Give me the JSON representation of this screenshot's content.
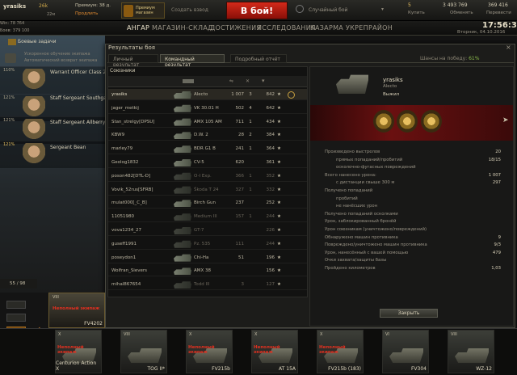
{
  "topbar": {
    "username": "yrasiks",
    "xp_label": "26k",
    "xp_total": "22м",
    "premium_label": "Премиум: 38 д.",
    "extend_label": "Продлить",
    "premium_shop": "Премиум магазин",
    "create_platoon": "Создать взвод",
    "battle_button": "В бой!",
    "battle_mode": "Случайный бой",
    "gold": "5",
    "buy_label": "Купить",
    "credits": "3 493 769",
    "exchange_label": "Обменять",
    "free_xp": "369 416",
    "convert_label": "Перевести",
    "time": "17:56:33",
    "date": "Вторник, 04.10.2016",
    "stat_line1": "Win: 78 764",
    "stat_line2": "Боев: 379 100"
  },
  "nav": [
    "АНГАР",
    "МАГАЗИН-СКЛАД",
    "ДОСТИЖЕНИЯ",
    "ИССЛЕДОВАНИЯ",
    "КАЗАРМА",
    "УКРЕПРАЙОН"
  ],
  "left": {
    "missions_label": "Боевые задачи",
    "boost_line1": "Ускоренное обучение экипажа",
    "boost_line2": "Автоматический возврат экипажа",
    "crew": [
      {
        "pct": "110%",
        "name": "Warrant Officer Class 2"
      },
      {
        "pct": "121%",
        "name": "Staff Sergeant Southgate"
      },
      {
        "pct": "121%",
        "name": "Staff Sergeant Allberry"
      },
      {
        "pct": "121%",
        "name": "Sergeant Bean"
      }
    ],
    "tank_count": "55 / 98"
  },
  "dialog": {
    "title": "Результаты боя",
    "tabs": [
      "Личный результат",
      "Командный результат",
      "Подробный отчёт"
    ],
    "win_chance_label": "Шансы на победу:",
    "win_chance_value": "61%",
    "team_label": "Союзники",
    "players": [
      {
        "name": "yrasiks",
        "tank": "Alecto",
        "dmg": "1 007",
        "kills": "3",
        "xp": "842",
        "me": true,
        "dead": false
      },
      {
        "name": "jager_metkij",
        "tank": "VK 30.01 H",
        "dmg": "502",
        "kills": "4",
        "xp": "642",
        "me": false,
        "dead": false
      },
      {
        "name": "Stan_strelgy[DPSU]",
        "tank": "AMX 105 AM",
        "dmg": "711",
        "kills": "1",
        "xp": "434",
        "me": false,
        "dead": false
      },
      {
        "name": "KBW9",
        "tank": "D.W. 2",
        "dmg": "28",
        "kills": "2",
        "xp": "384",
        "me": false,
        "dead": false
      },
      {
        "name": "marley79",
        "tank": "BDR G1 B",
        "dmg": "241",
        "kills": "1",
        "xp": "364",
        "me": false,
        "dead": false
      },
      {
        "name": "Geolog1832",
        "tank": "CV-5",
        "dmg": "620",
        "kills": "",
        "xp": "361",
        "me": false,
        "dead": false
      },
      {
        "name": "poson482[DTL-D]",
        "tank": "O-I Exp.",
        "dmg": "366",
        "kills": "1",
        "xp": "352",
        "me": false,
        "dead": true
      },
      {
        "name": "Vovik_52rus[SFRB]",
        "tank": "Škoda T 24",
        "dmg": "327",
        "kills": "1",
        "xp": "332",
        "me": false,
        "dead": true
      },
      {
        "name": "mulat000[_C_B]",
        "tank": "Birch Gun",
        "dmg": "237",
        "kills": "",
        "xp": "252",
        "me": false,
        "dead": false
      },
      {
        "name": "11051980",
        "tank": "Medium III",
        "dmg": "157",
        "kills": "1",
        "xp": "244",
        "me": false,
        "dead": true
      },
      {
        "name": "vova1234_27",
        "tank": "GT-7",
        "dmg": "",
        "kills": "",
        "xp": "226",
        "me": false,
        "dead": true
      },
      {
        "name": "guseff1991",
        "tank": "Pz. 535",
        "dmg": "111",
        "kills": "",
        "xp": "244",
        "me": false,
        "dead": true
      },
      {
        "name": "poseydon1",
        "tank": "Chi-Ha",
        "dmg": "51",
        "kills": "",
        "xp": "196",
        "me": false,
        "dead": false
      },
      {
        "name": "Wolfran_Sievers",
        "tank": "AMX 38",
        "dmg": "",
        "kills": "",
        "xp": "156",
        "me": false,
        "dead": false
      },
      {
        "name": "mihal867654",
        "tank": "Todd III",
        "dmg": "3",
        "kills": "",
        "xp": "127",
        "me": false,
        "dead": true
      }
    ],
    "detail": {
      "player": "yrasiks",
      "tank": "Alecto",
      "status": "Выжил",
      "stats": [
        {
          "label": "Произведено выстрелов",
          "value": "20",
          "indent": false
        },
        {
          "label": "прямых попаданий/пробитий",
          "value": "18/15",
          "indent": true
        },
        {
          "label": "осколочно-фугасных повреждений",
          "value": "",
          "indent": true
        },
        {
          "label": "Всего нанесено урона:",
          "value": "1 007",
          "indent": false
        },
        {
          "label": "с дистанции свыше 300 м",
          "value": "297",
          "indent": true
        },
        {
          "label": "Получено попаданий",
          "value": "",
          "indent": false
        },
        {
          "label": "пробитий",
          "value": "",
          "indent": true
        },
        {
          "label": "не нанёсших урон",
          "value": "",
          "indent": true
        },
        {
          "label": "Получено попаданий осколками",
          "value": "",
          "indent": false
        },
        {
          "label": "Урон, заблокированный бронёй",
          "value": "",
          "indent": false
        },
        {
          "label": "Урон союзникам (уничтожено/повреждений)",
          "value": "",
          "indent": false
        },
        {
          "label": "Обнаружено машин противника",
          "value": "9",
          "indent": false
        },
        {
          "label": "Повреждено/уничтожено машин противника",
          "value": "9/3",
          "indent": false
        },
        {
          "label": "Урон, нанесённый с вашей помощью",
          "value": "479",
          "indent": false
        },
        {
          "label": "Очки захвата/защиты базы",
          "value": "",
          "indent": false
        },
        {
          "label": "Пройдено километров",
          "value": "1,03",
          "indent": false
        }
      ],
      "close_button": "Закрыть"
    }
  },
  "carousel": [
    {
      "tier": "X",
      "name": "Centurion Action X",
      "warn": "Неполный экипаж"
    },
    {
      "tier": "VIII",
      "name": "TOG II*",
      "warn": ""
    },
    {
      "tier": "X",
      "name": "FV215b",
      "warn": "Неполный экипаж"
    },
    {
      "tier": "X",
      "name": "AT 15A",
      "warn": "Неполный экипаж"
    },
    {
      "tier": "X",
      "name": "FV215b (183)",
      "warn": "Неполный экипаж"
    },
    {
      "tier": "VI",
      "name": "FV304",
      "warn": ""
    },
    {
      "tier": "VIII",
      "name": "WZ-12",
      "warn": ""
    }
  ],
  "carousel_top": {
    "name": "FV4202",
    "warn": "Неполный экипаж",
    "tier": "VIII"
  },
  "colors": {
    "accent_red": "#c81e10",
    "win_green": "#8ab94a",
    "gold": "#e8c060"
  }
}
